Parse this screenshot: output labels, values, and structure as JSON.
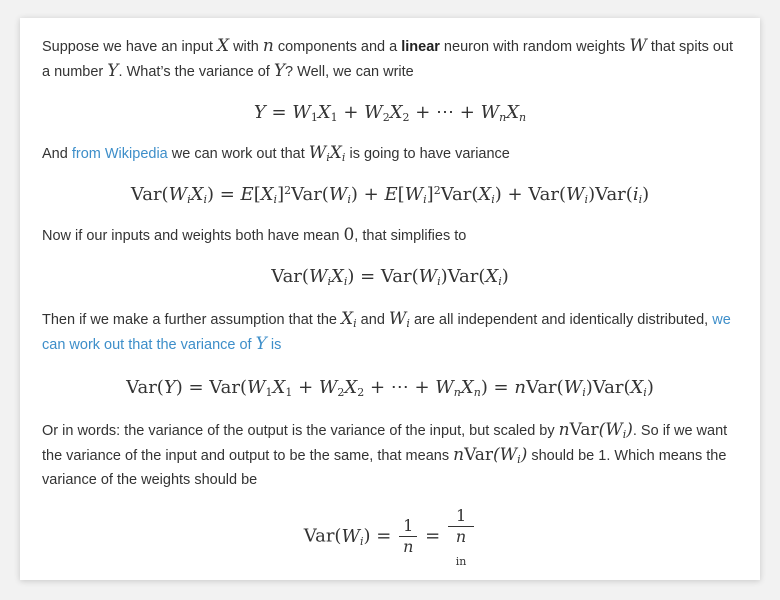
{
  "para1": {
    "t1": "Suppose we have an input ",
    "t2": " with ",
    "t3": " components and a ",
    "bold": "linear",
    "t4": " neuron with random weights ",
    "t5": " that spits out a number ",
    "t6": ". What’s the variance of ",
    "t7": "? Well, we can write"
  },
  "para2": {
    "t1": "And ",
    "link": "from Wikipedia",
    "t2": " we can work out that ",
    "t3": " is going to have variance"
  },
  "para3": {
    "t1": "Now if our inputs and weights both have mean ",
    "zero": "0",
    "t2": ", that simplifies to"
  },
  "para4": {
    "t1": "Then if we make a further assumption that the ",
    "t2": " and ",
    "t3": " are all independent and identically distributed, ",
    "link": "we can work out that the variance of ",
    "link_end": " is"
  },
  "para5": {
    "t1": "Or in words: the variance of the output is the variance of the input, but scaled by ",
    "t2": ". So if we want the variance of the input and output to be the same, that means ",
    "t3": " should be 1. Which means the variance of the weights should be"
  },
  "frac": {
    "one": "1",
    "n": "n",
    "in": "in"
  }
}
